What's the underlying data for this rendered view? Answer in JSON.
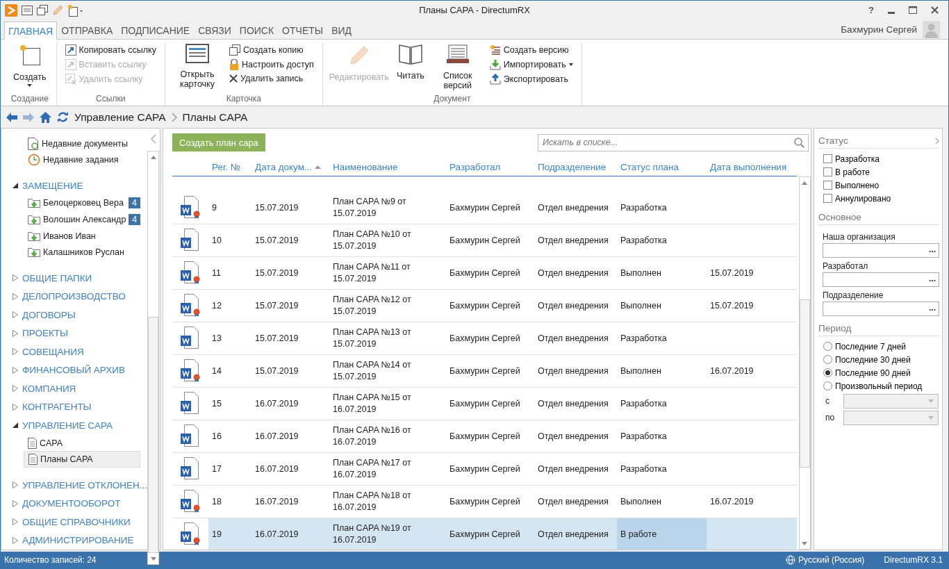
{
  "window": {
    "title": "Планы CAPA - DirectumRX",
    "help": "?"
  },
  "tabs": [
    {
      "label": "ГЛАВНАЯ",
      "selected": true
    },
    {
      "label": "ОТПРАВКА",
      "selected": false
    },
    {
      "label": "ПОДПИСАНИЕ",
      "selected": false
    },
    {
      "label": "СВЯЗИ",
      "selected": false
    },
    {
      "label": "ПОИСК",
      "selected": false
    },
    {
      "label": "ОТЧЕТЫ",
      "selected": false
    },
    {
      "label": "ВИД",
      "selected": false
    }
  ],
  "user": {
    "name": "Бахмурин Сергей"
  },
  "ribbon": {
    "groups": [
      {
        "label": "Создание",
        "items": [
          {
            "kind": "large",
            "label": "Создать",
            "disabled": false,
            "dropdown": true
          }
        ]
      },
      {
        "label": "Ссылки",
        "items": [
          {
            "kind": "small",
            "label": "Копировать ссылку",
            "disabled": false,
            "dropdown": false
          },
          {
            "kind": "small",
            "label": "Вставить ссылку",
            "disabled": true,
            "dropdown": false
          },
          {
            "kind": "small",
            "label": "Удалить ссылку",
            "disabled": true,
            "dropdown": false
          }
        ]
      },
      {
        "label": "Карточка",
        "items": [
          {
            "kind": "large",
            "label": "Открыть карточку",
            "disabled": false,
            "dropdown": false
          },
          {
            "kind": "small",
            "label": "Создать копию",
            "disabled": false,
            "dropdown": false
          },
          {
            "kind": "small",
            "label": "Настроить доступ",
            "disabled": false,
            "dropdown": false
          },
          {
            "kind": "small",
            "label": "Удалить запись",
            "disabled": false,
            "dropdown": false
          }
        ]
      },
      {
        "label": "Документ",
        "items": [
          {
            "kind": "large",
            "label": "Редактировать",
            "disabled": true,
            "dropdown": false
          },
          {
            "kind": "large",
            "label": "Читать",
            "disabled": false,
            "dropdown": false
          },
          {
            "kind": "large",
            "label": "Список версий",
            "disabled": false,
            "dropdown": false
          },
          {
            "kind": "small",
            "label": "Создать версию",
            "disabled": false,
            "dropdown": false
          },
          {
            "kind": "small",
            "label": "Импортировать",
            "disabled": false,
            "dropdown": true
          },
          {
            "kind": "small",
            "label": "Экспортировать",
            "disabled": false,
            "dropdown": false
          }
        ]
      }
    ]
  },
  "breadcrumb": [
    "Управление CAPA",
    "Планы CAPA"
  ],
  "sidebar": {
    "items": [
      {
        "kind": "link",
        "label": "Недавние документы"
      },
      {
        "kind": "link",
        "label": "Недавние задания"
      },
      {
        "kind": "section",
        "label": "ЗАМЕЩЕНИЕ",
        "expanded": true,
        "children": [
          {
            "label": "Белоцерковец Вера",
            "badge": "4",
            "selected": false
          },
          {
            "label": "Волошин Александр",
            "badge": "4",
            "selected": false
          },
          {
            "label": "Иванов Иван",
            "selected": false
          },
          {
            "label": "Калашников Руслан",
            "selected": false
          }
        ]
      },
      {
        "kind": "section",
        "label": "ОБЩИЕ ПАПКИ",
        "expanded": false
      },
      {
        "kind": "section",
        "label": "ДЕЛОПРОИЗВОДСТВО",
        "expanded": false
      },
      {
        "kind": "section",
        "label": "ДОГОВОРЫ",
        "expanded": false
      },
      {
        "kind": "section",
        "label": "ПРОЕКТЫ",
        "expanded": false
      },
      {
        "kind": "section",
        "label": "СОВЕЩАНИЯ",
        "expanded": false
      },
      {
        "kind": "section",
        "label": "ФИНАНСОВЫЙ АРХИВ",
        "expanded": false
      },
      {
        "kind": "section",
        "label": "КОМПАНИЯ",
        "expanded": false
      },
      {
        "kind": "section",
        "label": "КОНТРАГЕНТЫ",
        "expanded": false
      },
      {
        "kind": "section",
        "label": "УПРАВЛЕНИЕ CAPA",
        "expanded": true,
        "children": [
          {
            "label": "CAPA",
            "selected": false
          },
          {
            "label": "Планы CAPA",
            "selected": true
          }
        ]
      },
      {
        "kind": "section",
        "label": "УПРАВЛЕНИЕ ОТКЛОНЕН...",
        "expanded": false
      },
      {
        "kind": "section",
        "label": "ДОКУМЕНТООБОРОТ",
        "expanded": false
      },
      {
        "kind": "section",
        "label": "ОБЩИЕ СПРАВОЧНИКИ",
        "expanded": false
      },
      {
        "kind": "section",
        "label": "АДМИНИСТРИРОВАНИЕ",
        "expanded": false
      }
    ]
  },
  "toolbar": {
    "create_button": "Создать план сара",
    "search": {
      "placeholder": "Искать в списке..."
    }
  },
  "table": {
    "columns": [
      {
        "label": "Рег. №",
        "sorted": false
      },
      {
        "label": "Дата докум...",
        "sorted": true
      },
      {
        "label": "Наименование",
        "sorted": false
      },
      {
        "label": "Разработал",
        "sorted": false
      },
      {
        "label": "Подразделение",
        "sorted": false
      },
      {
        "label": "Статус плана",
        "sorted": false
      },
      {
        "label": "Дата выполнения",
        "sorted": false
      }
    ],
    "rows": [
      {
        "signed": true,
        "selected": false,
        "cells": [
          "9",
          "15.07.2019",
          "План CAPA №9 от 15.07.2019",
          "Бахмурин Сергей",
          "Отдел внедрения",
          "Разработка",
          ""
        ]
      },
      {
        "signed": false,
        "selected": false,
        "cells": [
          "10",
          "15.07.2019",
          "План CAPA №10 от 15.07.2019",
          "Бахмурин Сергей",
          "Отдел внедрения",
          "Разработка",
          ""
        ]
      },
      {
        "signed": true,
        "selected": false,
        "cells": [
          "11",
          "15.07.2019",
          "План CAPA №11 от 15.07.2019",
          "Бахмурин Сергей",
          "Отдел внедрения",
          "Выполнен",
          "15.07.2019"
        ]
      },
      {
        "signed": true,
        "selected": false,
        "cells": [
          "12",
          "15.07.2019",
          "План CAPA №12 от 15.07.2019",
          "Бахмурин Сергей",
          "Отдел внедрения",
          "Выполнен",
          "15.07.2019"
        ]
      },
      {
        "signed": false,
        "selected": false,
        "cells": [
          "13",
          "15.07.2019",
          "План CAPA №13 от 15.07.2019",
          "Бахмурин Сергей",
          "Отдел внедрения",
          "Разработка",
          ""
        ]
      },
      {
        "signed": true,
        "selected": false,
        "cells": [
          "14",
          "15.07.2019",
          "План CAPA №14 от 15.07.2019",
          "Бахмурин Сергей",
          "Отдел внедрения",
          "Выполнен",
          "16.07.2019"
        ]
      },
      {
        "signed": false,
        "selected": false,
        "cells": [
          "15",
          "16.07.2019",
          "План CAPA №15 от 16.07.2019",
          "Бахмурин Сергей",
          "Отдел внедрения",
          "Разработка",
          ""
        ]
      },
      {
        "signed": false,
        "selected": false,
        "cells": [
          "16",
          "16.07.2019",
          "План CAPA №16 от 16.07.2019",
          "Бахмурин Сергей",
          "Отдел внедрения",
          "Разработка",
          ""
        ]
      },
      {
        "signed": false,
        "selected": false,
        "cells": [
          "17",
          "16.07.2019",
          "План CAPA №17 от 16.07.2019",
          "Бахмурин Сергей",
          "Отдел внедрения",
          "Разработка",
          ""
        ]
      },
      {
        "signed": true,
        "selected": false,
        "cells": [
          "18",
          "16.07.2019",
          "План CAPA №18 от 16.07.2019",
          "Бахмурин Сергей",
          "Отдел внедрения",
          "Выполнен",
          "16.07.2019"
        ]
      },
      {
        "signed": true,
        "selected": true,
        "cells": [
          "19",
          "16.07.2019",
          "План CAPA №19 от 16.07.2019",
          "Бахмурин Сергей",
          "Отдел внедрения",
          "В работе",
          ""
        ]
      }
    ]
  },
  "filter": {
    "sections": [
      {
        "kind": "checks",
        "title": "Статус",
        "items": [
          {
            "label": "Разработка",
            "checked": false
          },
          {
            "label": "В работе",
            "checked": false
          },
          {
            "label": "Выполнено",
            "checked": false
          },
          {
            "label": "Аннулировано",
            "checked": false
          }
        ]
      },
      {
        "kind": "fields",
        "title": "Основное",
        "items": [
          {
            "label": "Наша организация",
            "button": "..."
          },
          {
            "label": "Разработал",
            "button": "..."
          },
          {
            "label": "Подразделение",
            "button": "..."
          }
        ]
      },
      {
        "kind": "radios",
        "title": "Период",
        "items": [
          {
            "label": "Последние 7 дней",
            "selected": false
          },
          {
            "label": "Последние 30 дней",
            "selected": false
          },
          {
            "label": "Последние 90 дней",
            "selected": true
          },
          {
            "label": "Произвольный период",
            "selected": false
          }
        ],
        "ranges": [
          {
            "label": "с",
            "disabled": true
          },
          {
            "label": "по",
            "disabled": true
          }
        ]
      }
    ]
  },
  "status_bar": {
    "count": "Количество записей: 24",
    "language": "Русский (Россия)",
    "version": "DirectumRX 3.1"
  }
}
